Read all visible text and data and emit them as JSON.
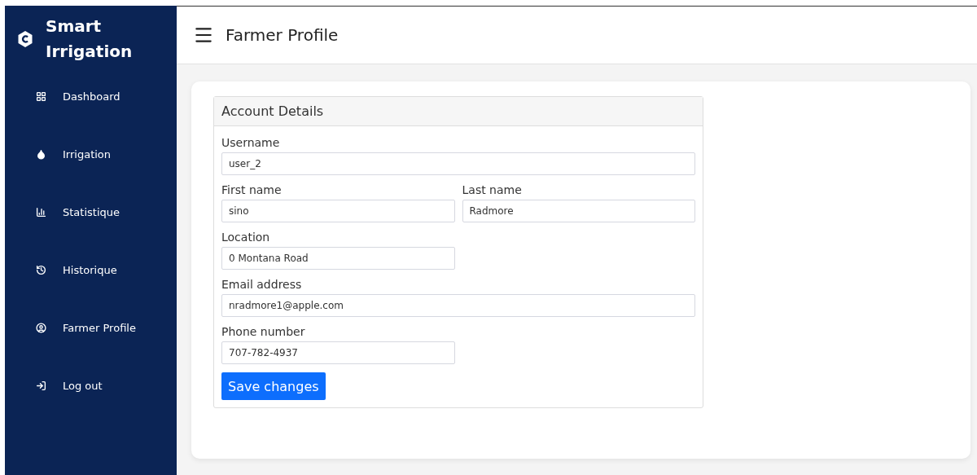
{
  "sidebar": {
    "brand": "Smart Irrigation",
    "items": [
      {
        "label": "Dashboard"
      },
      {
        "label": "Irrigation"
      },
      {
        "label": "Statistique"
      },
      {
        "label": "Historique"
      },
      {
        "label": "Farmer Profile"
      },
      {
        "label": "Log out"
      }
    ]
  },
  "header": {
    "title": "Farmer Profile"
  },
  "panel": {
    "title": "Account Details",
    "rows": [
      [
        {
          "label": "Username",
          "value": "user_2",
          "kind": "wide"
        }
      ],
      [
        {
          "label": "First name",
          "value": "sino",
          "kind": "narrow"
        },
        {
          "label": "Last name",
          "value": "Radmore",
          "kind": "narrow"
        }
      ],
      [
        {
          "label": "Location",
          "value": "0 Montana Road",
          "kind": "narrow"
        }
      ],
      [
        {
          "label": "Email address",
          "value": "nradmore1@apple.com",
          "kind": "wide"
        }
      ],
      [
        {
          "label": "Phone number",
          "value": "707-782-4937",
          "kind": "narrow"
        }
      ]
    ],
    "button": "Save changes"
  }
}
